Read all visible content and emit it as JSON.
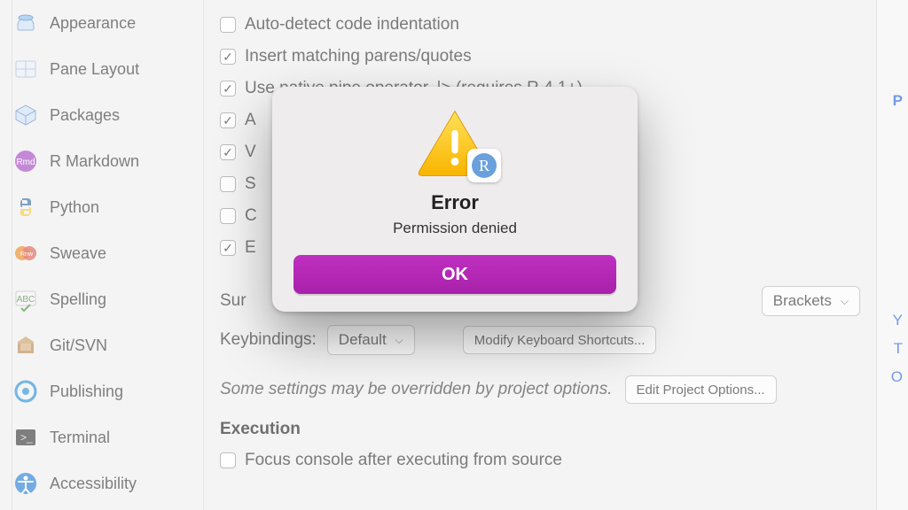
{
  "sidebar": {
    "items": [
      {
        "label": "Appearance",
        "icon": "appearance"
      },
      {
        "label": "Pane Layout",
        "icon": "pane"
      },
      {
        "label": "Packages",
        "icon": "packages"
      },
      {
        "label": "R Markdown",
        "icon": "rmd"
      },
      {
        "label": "Python",
        "icon": "python"
      },
      {
        "label": "Sweave",
        "icon": "sweave"
      },
      {
        "label": "Spelling",
        "icon": "spelling"
      },
      {
        "label": "Git/SVN",
        "icon": "git"
      },
      {
        "label": "Publishing",
        "icon": "publishing"
      },
      {
        "label": "Terminal",
        "icon": "terminal"
      },
      {
        "label": "Accessibility",
        "icon": "accessibility"
      }
    ]
  },
  "options": {
    "rows": [
      {
        "checked": false,
        "label": "Auto-detect code indentation"
      },
      {
        "checked": true,
        "label": "Insert matching parens/quotes"
      },
      {
        "checked": true,
        "label": "Use native pipe operator, |> (requires R 4.1+)"
      },
      {
        "checked": true,
        "label": "A"
      },
      {
        "checked": true,
        "label": "V"
      },
      {
        "checked": false,
        "label": "S"
      },
      {
        "checked": false,
        "label": "C"
      },
      {
        "checked": true,
        "label": "E"
      }
    ],
    "surround_label": "Sur",
    "surround_value": "Brackets",
    "keybindings_label": "Keybindings:",
    "keybindings_value": "Default",
    "modify_shortcuts": "Modify Keyboard Shortcuts...",
    "note": "Some settings may be overridden by project options.",
    "edit_project": "Edit Project Options...",
    "section_execution": "Execution",
    "exec_focus_console": "Focus console after executing from source"
  },
  "modal": {
    "title": "Error",
    "message": "Permission denied",
    "ok": "OK"
  },
  "right_peek": {
    "p": "P",
    "y": "Y",
    "t": "T",
    "o": "O"
  }
}
